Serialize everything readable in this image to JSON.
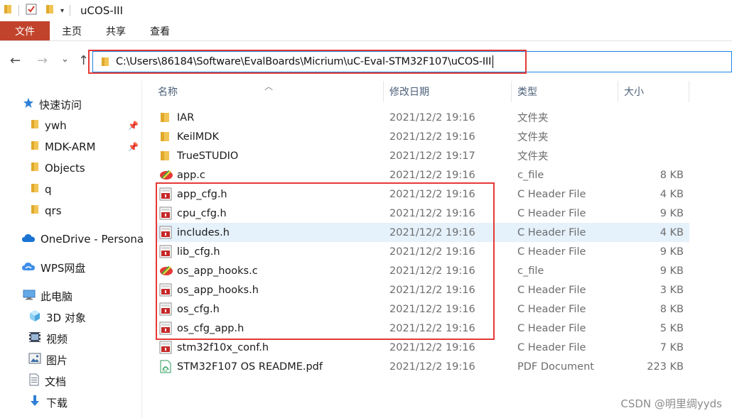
{
  "window": {
    "title": "uCOS-III"
  },
  "ribbon": {
    "tabs": [
      "文件",
      "主页",
      "共享",
      "查看"
    ]
  },
  "address": {
    "path": "C:\\Users\\86184\\Software\\EvalBoards\\Micrium\\uC-Eval-STM32F107\\uCOS-III"
  },
  "nav": {
    "back": "←",
    "forward": "→",
    "recent": "⌄",
    "up": "↑"
  },
  "sidebar": {
    "quick_access": "快速访问",
    "pinned": [
      "ywh",
      "MDK-ARM",
      "Objects",
      "q",
      "qrs"
    ],
    "onedrive": "OneDrive - Persona",
    "wps": "WPS网盘",
    "this_pc": "此电脑",
    "pc_items": [
      "3D 对象",
      "视频",
      "图片",
      "文档",
      "下载"
    ]
  },
  "columns": {
    "name": "名称",
    "modified": "修改日期",
    "type": "类型",
    "size": "大小"
  },
  "files": [
    {
      "name": "IAR",
      "date": "2021/12/2 19:16",
      "type": "文件夹",
      "size": "",
      "icon": "folder"
    },
    {
      "name": "KeilMDK",
      "date": "2021/12/2 19:16",
      "type": "文件夹",
      "size": "",
      "icon": "folder"
    },
    {
      "name": "TrueSTUDIO",
      "date": "2021/12/2 19:17",
      "type": "文件夹",
      "size": "",
      "icon": "folder"
    },
    {
      "name": "app.c",
      "date": "2021/12/2 19:16",
      "type": "c_file",
      "size": "8 KB",
      "icon": "c-file"
    },
    {
      "name": "app_cfg.h",
      "date": "2021/12/2 19:16",
      "type": "C Header File",
      "size": "4 KB",
      "icon": "h-file"
    },
    {
      "name": "cpu_cfg.h",
      "date": "2021/12/2 19:16",
      "type": "C Header File",
      "size": "9 KB",
      "icon": "h-file"
    },
    {
      "name": "includes.h",
      "date": "2021/12/2 19:16",
      "type": "C Header File",
      "size": "4 KB",
      "icon": "h-file"
    },
    {
      "name": "lib_cfg.h",
      "date": "2021/12/2 19:16",
      "type": "C Header File",
      "size": "9 KB",
      "icon": "h-file"
    },
    {
      "name": "os_app_hooks.c",
      "date": "2021/12/2 19:16",
      "type": "c_file",
      "size": "9 KB",
      "icon": "c-file"
    },
    {
      "name": "os_app_hooks.h",
      "date": "2021/12/2 19:16",
      "type": "C Header File",
      "size": "3 KB",
      "icon": "h-file"
    },
    {
      "name": "os_cfg.h",
      "date": "2021/12/2 19:16",
      "type": "C Header File",
      "size": "8 KB",
      "icon": "h-file"
    },
    {
      "name": "os_cfg_app.h",
      "date": "2021/12/2 19:16",
      "type": "C Header File",
      "size": "5 KB",
      "icon": "h-file"
    },
    {
      "name": "stm32f10x_conf.h",
      "date": "2021/12/2 19:16",
      "type": "C Header File",
      "size": "7 KB",
      "icon": "h-file"
    },
    {
      "name": "STM32F107 OS README.pdf",
      "date": "2021/12/2 19:16",
      "type": "PDF Document",
      "size": "223 KB",
      "icon": "pdf-file"
    }
  ],
  "selected_file": "includes.h",
  "watermark": "CSDN @明里绸yyds",
  "colors": {
    "accent": "#1c86e6",
    "file_tab": "#c1432c",
    "highlight": "#e53935",
    "selected_row": "#e5f1fb",
    "folder": "#f1c453"
  }
}
